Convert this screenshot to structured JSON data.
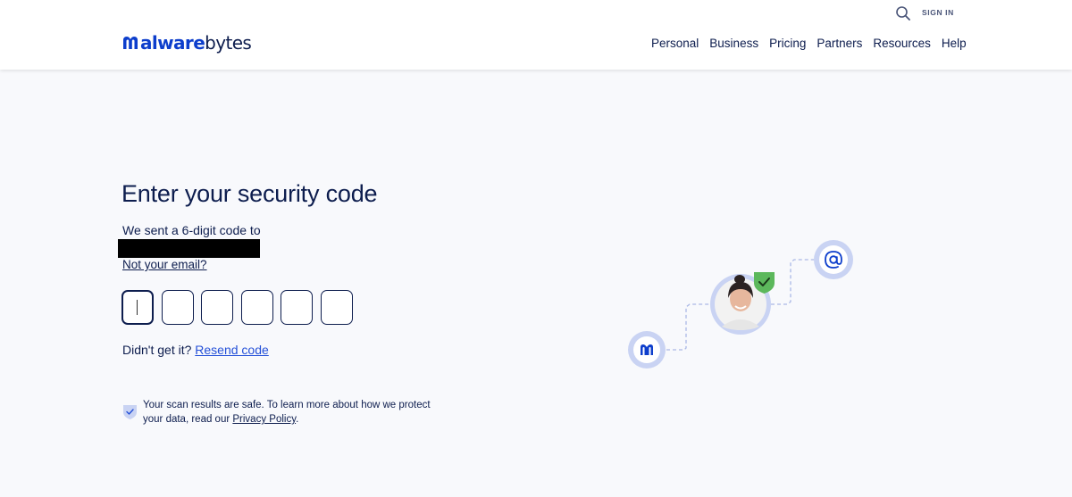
{
  "header": {
    "logo_text_m": "M",
    "logo_text_alware": "alware",
    "logo_text_bytes": "bytes",
    "search_icon": "search-icon",
    "signin_label": "SIGN IN",
    "nav": [
      {
        "label": "Personal"
      },
      {
        "label": "Business"
      },
      {
        "label": "Pricing"
      },
      {
        "label": "Partners"
      },
      {
        "label": "Resources"
      },
      {
        "label": "Help"
      }
    ]
  },
  "verify": {
    "title": "Enter your security code",
    "sent_text": "We sent a 6-digit code to",
    "email_redacted": "",
    "not_email_link": "Not your email?",
    "code_digits": [
      "",
      "",
      "",
      "",
      "",
      ""
    ],
    "resend_prefix": "Didn't get it?",
    "resend_link": "Resend code"
  },
  "notice": {
    "icon": "shield-check-icon",
    "text": "Your scan results are safe. To learn more about how we protect your data, read our",
    "privacy_link": "Privacy Policy",
    "suffix": "."
  },
  "illustration": {
    "icons": [
      "malwarebytes-m-icon",
      "avatar-photo",
      "check-badge-icon",
      "at-sign-icon"
    ]
  },
  "colors": {
    "brand_blue": "#0d3ecc",
    "navy": "#0d1d4e",
    "link_blue": "#2450d8",
    "check_green": "#5cb85c",
    "circle_ring": "#c9d3f3"
  }
}
